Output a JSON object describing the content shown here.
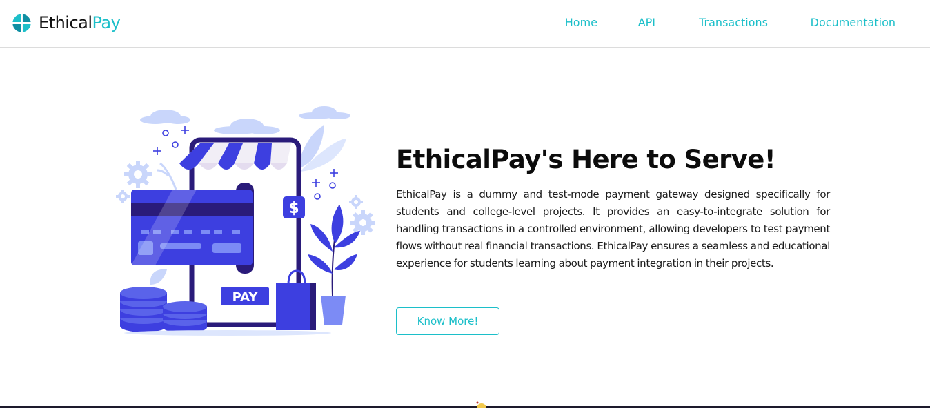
{
  "brand": {
    "name_part1": "Ethical",
    "name_part2": "Pay"
  },
  "nav": {
    "links": [
      "Home",
      "API",
      "Transactions",
      "Documentation"
    ]
  },
  "hero": {
    "title": "EthicalPay's Here to Serve!",
    "description": "EthicalPay is a dummy and test-mode payment gateway designed specifically for students and college-level projects. It provides an easy-to-integrate solution for handling transactions in a controlled environment, allowing developers to test payment flows without real financial transactions. EthicalPay ensures a seamless and educational experience for students learning about payment integration in their projects.",
    "cta_label": "Know More!",
    "illustration": {
      "pay_label": "PAY",
      "dollar_sign": "$"
    }
  },
  "colors": {
    "accent": "#1cbfc9",
    "illustration_primary": "#3d3fe0",
    "illustration_dark": "#2a1b7a",
    "illustration_light": "#c9d6fb"
  },
  "icons": [
    "ethicalpay-logo-icon",
    "storefront-illustration",
    "credit-card-icon",
    "coin-stack-icon",
    "shopping-bag-icon",
    "plant-icon",
    "gear-icon",
    "cloud-icon",
    "dollar-icon"
  ]
}
